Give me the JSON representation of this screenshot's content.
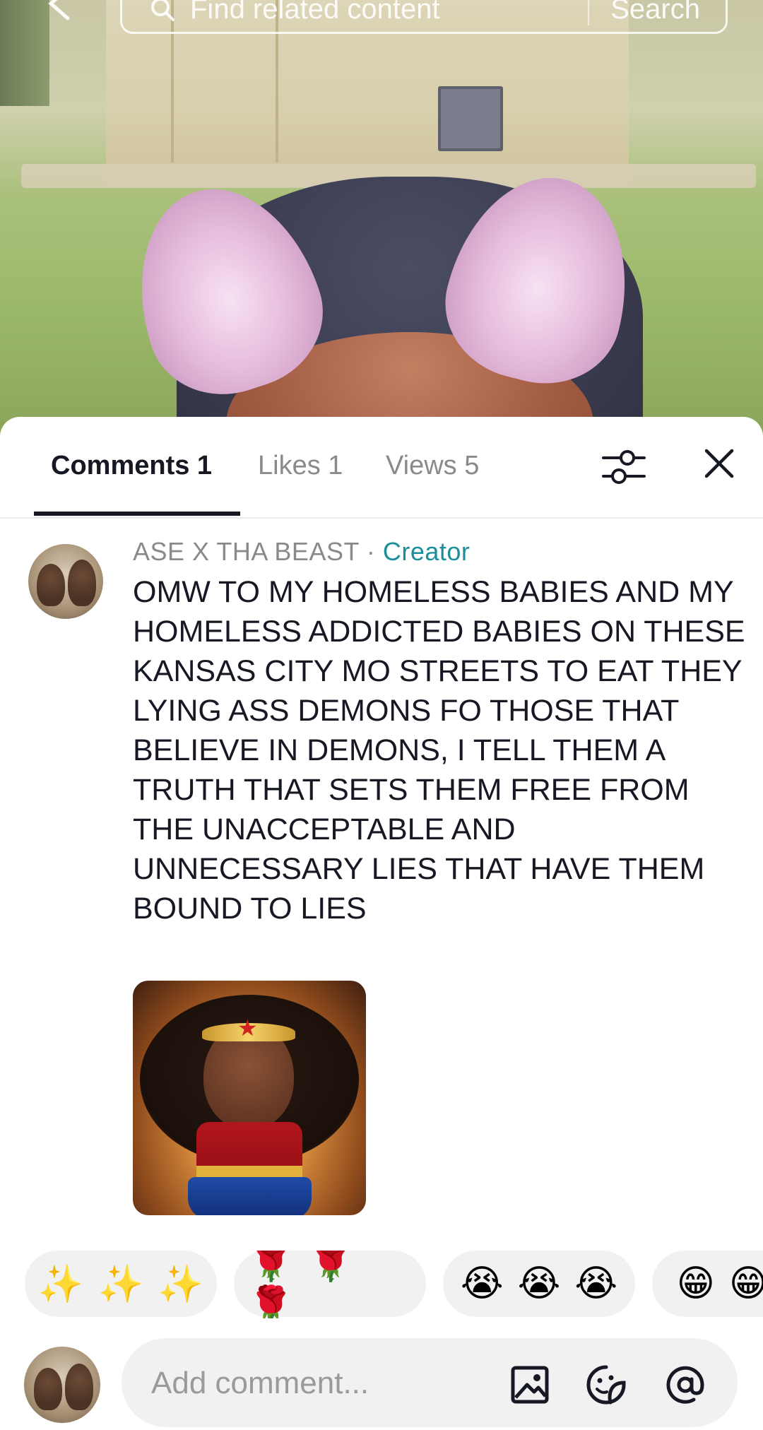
{
  "search": {
    "placeholder": "Find related content",
    "button_label": "Search"
  },
  "tabs": [
    {
      "label": "Comments 1",
      "active": true
    },
    {
      "label": "Likes 1",
      "active": false
    },
    {
      "label": "Views 5",
      "active": false
    }
  ],
  "comment": {
    "username": "ASE X THA BEAST",
    "separator": "·",
    "badge": "Creator",
    "text": "OMW TO MY HOMELESS BABIES AND MY HOMELESS ADDICTED BABIES ON THESE KANSAS CITY MO STREETS TO EAT THEY LYING ASS DEMONS FO THOSE THAT BELIEVE IN DEMONS, I TELL THEM A TRUTH THAT SETS THEM FREE FROM THE UNACCEPTABLE AND UNNECESSARY LIES THAT HAVE THEM BOUND TO LIES"
  },
  "reactions": [
    "✨✨✨",
    "🌹🌹🌹",
    "😭😭😭",
    "😁😁😁"
  ],
  "composer": {
    "placeholder": "Add comment..."
  },
  "icons": {
    "back": "back-arrow-icon",
    "search": "search-icon",
    "filter": "filter-sliders-icon",
    "close": "close-icon",
    "image": "image-icon",
    "sticker": "sticker-icon",
    "mention": "at-icon"
  },
  "colors": {
    "creator_badge": "#1a8f9a",
    "text_primary": "#161823",
    "text_secondary": "#8a8a8a",
    "pill_bg": "#f1f1f2"
  }
}
